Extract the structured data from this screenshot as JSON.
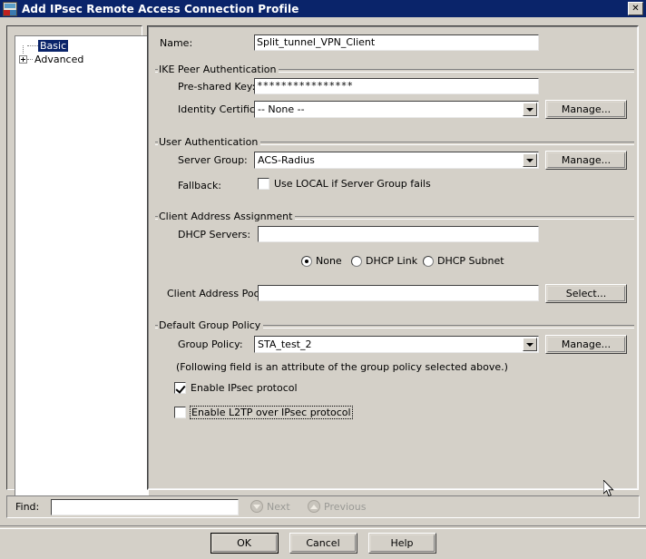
{
  "window": {
    "title": "Add IPsec Remote Access Connection Profile",
    "icon": "ipsec-profile-icon",
    "close_label": "✕",
    "accent_titlebar": "#0a246a",
    "face_color": "#d4d0c8"
  },
  "tree": {
    "items": [
      {
        "label": "Basic",
        "selected": true,
        "expandable": false
      },
      {
        "label": "Advanced",
        "selected": false,
        "expandable": true,
        "expander": "+"
      }
    ]
  },
  "form": {
    "name": {
      "label": "Name:",
      "value": "Split_tunnel_VPN_Client"
    },
    "ike_peer_auth": {
      "title": "IKE Peer Authentication",
      "preshared_key": {
        "label": "Pre-shared Key:",
        "value": "****************"
      },
      "identity_certificate": {
        "label": "Identity Certificate:",
        "value": "-- None --",
        "manage_label": "Manage..."
      }
    },
    "user_auth": {
      "title": "User Authentication",
      "server_group": {
        "label": "Server Group:",
        "value": "ACS-Radius",
        "manage_label": "Manage..."
      },
      "fallback": {
        "label": "Fallback:",
        "checkbox_label": "Use LOCAL if Server Group fails",
        "checked": false
      }
    },
    "client_address_assignment": {
      "title": "Client Address Assignment",
      "dhcp_servers": {
        "label": "DHCP Servers:",
        "value": ""
      },
      "radios": [
        {
          "label": "None",
          "checked": true
        },
        {
          "label": "DHCP Link",
          "checked": false
        },
        {
          "label": "DHCP Subnet",
          "checked": false
        }
      ],
      "client_address_pools": {
        "label": "Client Address Pools:",
        "value": "",
        "select_label": "Select..."
      }
    },
    "default_group_policy": {
      "title": "Default Group Policy",
      "group_policy": {
        "label": "Group Policy:",
        "value": "STA_test_2",
        "manage_label": "Manage..."
      },
      "note": "(Following field is an attribute of the group policy selected above.)",
      "enable_ipsec": {
        "label": "Enable IPsec protocol",
        "checked": true
      },
      "enable_l2tp": {
        "label": "Enable L2TP over IPsec protocol",
        "checked": false,
        "focused": true
      }
    }
  },
  "findbar": {
    "label": "Find:",
    "value": "",
    "next_label": "Next",
    "previous_label": "Previous",
    "disabled": true
  },
  "dialog_buttons": {
    "ok": "OK",
    "cancel": "Cancel",
    "help": "Help"
  }
}
